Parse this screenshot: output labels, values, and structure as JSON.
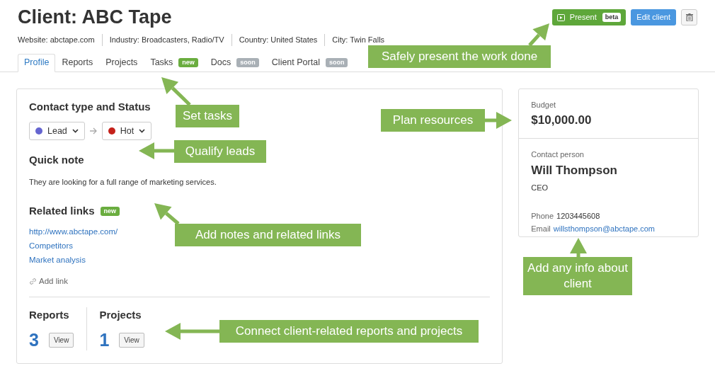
{
  "header": {
    "title": "Client: ABC Tape",
    "meta": [
      "Website: abctape.com",
      "Industry: Broadcasters, Radio/TV",
      "Country: United States",
      "City: Twin Falls"
    ],
    "actions": [
      {
        "kind": "present",
        "label": "Present",
        "badge": "beta"
      },
      {
        "kind": "edit",
        "label": "Edit client"
      },
      {
        "kind": "delete"
      }
    ]
  },
  "tabs": [
    {
      "label": "Profile",
      "selected": true
    },
    {
      "label": "Reports",
      "selected": false
    },
    {
      "label": "Projects",
      "selected": false
    },
    {
      "label": "Tasks",
      "selected": false,
      "badge": {
        "text": "new",
        "kind": "new"
      }
    },
    {
      "label": "Docs",
      "selected": false,
      "badge": {
        "text": "soon",
        "kind": "soon"
      }
    },
    {
      "label": "Client Portal",
      "selected": false,
      "badge": {
        "text": "soon",
        "kind": "soon"
      }
    }
  ],
  "contact": {
    "title": "Contact type and Status",
    "type": {
      "label": "Lead",
      "color": "#6565d0"
    },
    "status": {
      "label": "Hot",
      "color": "#c4211a"
    }
  },
  "quick_note": {
    "title": "Quick note",
    "text": "They are looking for a full range of marketing services."
  },
  "related_links": {
    "title": "Related links",
    "badge": "new",
    "links": [
      "http://www.abctape.com/",
      "Competitors",
      "Market analysis"
    ],
    "add_link": "Add link"
  },
  "counts": [
    {
      "title": "Reports",
      "count": "3",
      "button": "View"
    },
    {
      "title": "Projects",
      "count": "1",
      "button": "View"
    }
  ],
  "budget": {
    "label": "Budget",
    "amount": "$10,000.00"
  },
  "contact_person": {
    "label": "Contact person",
    "name": "Will Thompson",
    "role": "CEO",
    "phone_label": "Phone",
    "phone": "1203445608",
    "email_label": "Email",
    "email": "willsthompson@abctape.com"
  },
  "callouts": [
    {
      "text": "Safely present the work done"
    },
    {
      "text": "Set tasks"
    },
    {
      "text": "Plan resources"
    },
    {
      "text": "Qualify leads"
    },
    {
      "text": "Add notes and related links"
    },
    {
      "text": "Add any info about client"
    },
    {
      "text": "Connect client-related reports and projects"
    }
  ]
}
